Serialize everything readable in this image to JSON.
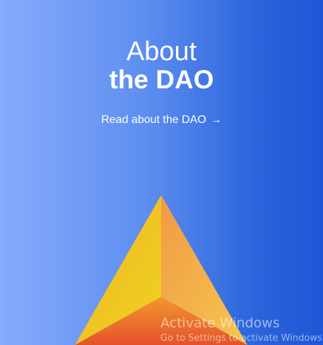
{
  "hero": {
    "title_line1": "About",
    "title_line2": "the DAO",
    "link_label": "Read about the DAO",
    "link_arrow": "→"
  },
  "colors": {
    "bg_left": "#86acfb",
    "bg_right": "#1f56d6",
    "pyramid_left_face": "#f0c41f",
    "pyramid_right_face": "#f0a04a",
    "pyramid_bottom": "#e8602a"
  },
  "watermark": {
    "title": "Activate Windows",
    "subtitle": "Go to Settings to activate Windows."
  }
}
